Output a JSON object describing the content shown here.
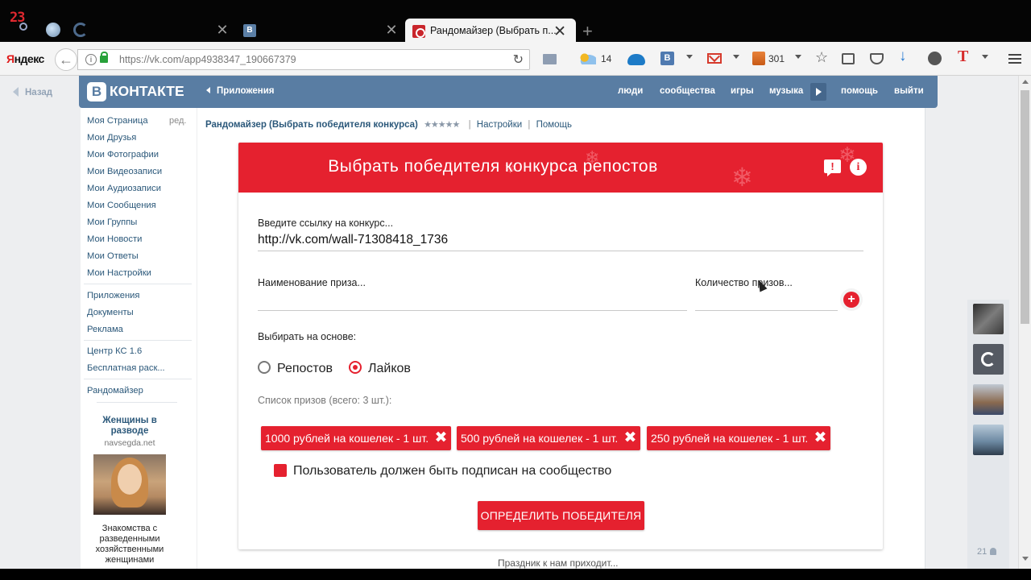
{
  "browser": {
    "clock_text": "23",
    "active_tab_title": "Рандомайзер (Выбрать п...",
    "vk_tab_icon_letter": "B",
    "close_glyph": "✕",
    "new_tab_glyph": "+",
    "yandex_logo_first": "Я",
    "yandex_logo_rest": "ндекс",
    "url_host": "https://vk.com/",
    "url_path": "app4938347_190667379",
    "weather_value": "14",
    "books_value": "301",
    "vk_ext_letter": "B",
    "t_letter": "T"
  },
  "vk": {
    "back_label": "Назад",
    "logo_letter": "B",
    "logo_text": "КОНТАКТЕ",
    "apps_label": "Приложения",
    "nav": [
      "люди",
      "сообщества",
      "игры",
      "музыка",
      "помощь",
      "выйти"
    ],
    "left_menu": [
      "Моя Страница",
      "Мои Друзья",
      "Мои Фотографии",
      "Мои Видеозаписи",
      "Мои Аудиозаписи",
      "Мои Сообщения",
      "Мои Группы",
      "Мои Новости",
      "Мои Ответы",
      "Мои Настройки"
    ],
    "left_menu_2": [
      "Приложения",
      "Документы",
      "Реклама"
    ],
    "left_menu_3": [
      "Центр КС 1.6",
      "Бесплатная раск..."
    ],
    "left_menu_4": [
      "Рандомайзер"
    ],
    "edit_label": "ред.",
    "ad": {
      "title": "Женщины в разводе",
      "site": "navsegda.net",
      "text": "Знакомства с разведенными хозяйственными женщинами"
    },
    "app_bar": {
      "name": "Рандомайзер (Выбрать победителя конкурса)",
      "stars": "★★★★★",
      "separator": "|",
      "settings": "Настройки",
      "help": "Помощь"
    },
    "footer_text": "Праздник к нам приходит...",
    "rail_count": "21"
  },
  "app": {
    "title": "Выбрать победителя конкурса репостов",
    "feedback_glyph": "!",
    "info_glyph": "i",
    "link_label": "Введите ссылку на конкурс...",
    "link_value": "http://vk.com/wall-71308418_1736",
    "prize_name_placeholder": "Наименование приза...",
    "prize_count_placeholder": "Количество призов...",
    "add_glyph": "+",
    "based_on_label": "Выбирать на основе:",
    "radio_reposts": "Репостов",
    "radio_likes": "Лайков",
    "radio_selected": "Лайков",
    "prize_list_label": "Список призов (всего: 3 шт.):",
    "prizes": [
      "1000 рублей на кошелек - 1 шт.",
      "500 рублей на кошелек - 1 шт.",
      "250 рублей на кошелек - 1 шт."
    ],
    "remove_glyph": "✖",
    "subscribe_checkbox": "Пользователь должен быть подписан на сообщество",
    "subscribe_checked": true,
    "winner_button": "ОПРЕДЕЛИТЬ ПОБЕДИТЕЛЯ",
    "accent_color": "#e5212f"
  }
}
